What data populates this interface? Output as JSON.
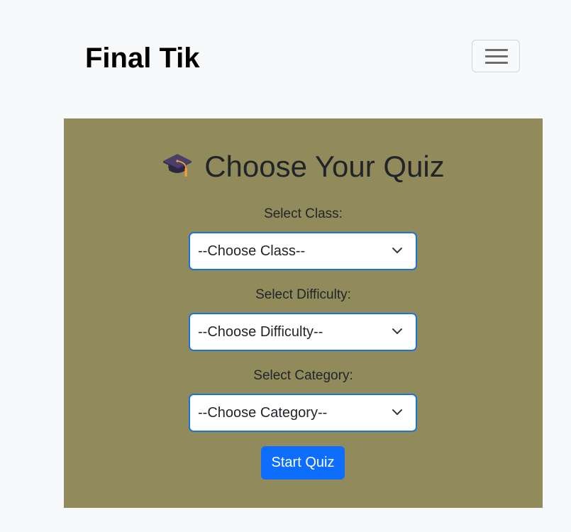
{
  "navbar": {
    "brand": "Final Tik",
    "toggler_icon": "hamburger-menu-icon"
  },
  "quiz": {
    "heading_icon": "graduation-cap-icon",
    "heading": "Choose Your Quiz",
    "class_field": {
      "label": "Select Class:",
      "selected": "--Choose Class--"
    },
    "difficulty_field": {
      "label": "Select Difficulty:",
      "selected": "--Choose Difficulty--"
    },
    "category_field": {
      "label": "Select Category:",
      "selected": "--Choose Category--"
    },
    "start_button": "Start Quiz"
  },
  "colors": {
    "page_background": "#f8f9fa",
    "panel_background": "#918b5c",
    "select_border": "#1a73d9",
    "primary_button": "#0d6efd"
  }
}
